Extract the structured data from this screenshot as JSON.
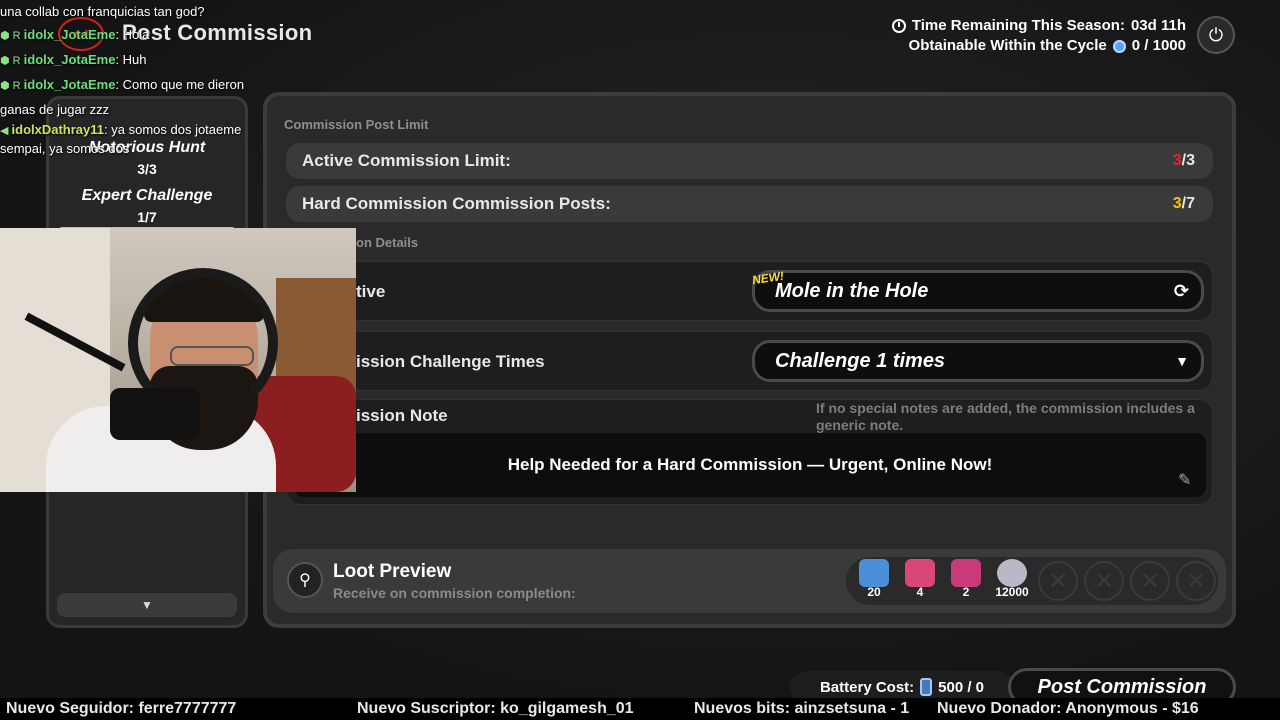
{
  "header": {
    "title": "Post Commission",
    "back_icon": "back-arrow-icon",
    "time_remaining_label": "Time Remaining This Season:",
    "time_remaining_value": "03d 11h",
    "obtainable_label": "Obtainable Within the Cycle",
    "obtainable_value": "0 / 1000"
  },
  "sidebar": {
    "items": [
      {
        "label": "Notorious Hunt",
        "count": "3/3"
      },
      {
        "label": "Expert Challenge",
        "count": "1/7"
      }
    ],
    "scroll_icon": "chevron-down-icon"
  },
  "limits": {
    "section_title": "Commission Post Limit",
    "active_label": "Active Commission Limit:",
    "active_used": "3",
    "active_total": "/3",
    "hard_label": "Hard Commission Commission Posts:",
    "hard_used": "3",
    "hard_total": "/7"
  },
  "details": {
    "section_title": "on Details",
    "objective_label": "tive",
    "objective_new": "NEW!",
    "objective_value": "Mole in the Hole",
    "challenge_label": "ission Challenge Times",
    "challenge_value": "Challenge 1 times",
    "note_label": "ission Note",
    "note_hint": "If no special notes are added, the commission includes a generic note.",
    "note_text": "Help Needed for a Hard Commission — Urgent, Online Now!"
  },
  "loot": {
    "title": "Loot Preview",
    "subtitle": "Receive on commission completion:",
    "items": [
      {
        "qty": "20",
        "color": "#4a8fd8"
      },
      {
        "qty": "4",
        "color": "#d8467a"
      },
      {
        "qty": "2",
        "color": "#c83a7a"
      },
      {
        "qty": "12000",
        "color": "#b8b8c8"
      }
    ]
  },
  "footer": {
    "battery_label": "Battery Cost:",
    "battery_value": "500 / 0",
    "post_button": "Post Commission"
  },
  "chat": [
    {
      "text": "una collab con franquicias tan god?"
    },
    {
      "user": "idolx_JotaEme",
      "msg": "Hola"
    },
    {
      "user": "idolx_JotaEme",
      "msg": "Huh"
    },
    {
      "user": "idolx_JotaEme",
      "msg": "Como que me dieron"
    },
    {
      "text": "ganas de jugar zzz"
    },
    {
      "user": "idolxDathray11",
      "msg": "ya somos dos jotaeme"
    },
    {
      "text": "sempai, ya somos dos"
    }
  ],
  "ticker": {
    "follower": "Nuevo Seguidor: ferre7777777",
    "subscriber": "Nuevo Suscriptor: ko_gilgamesh_01",
    "bits": "Nuevos bits: ainzsetsuna - 1",
    "donor": "Nuevo Donador: Anonymous - $16"
  }
}
